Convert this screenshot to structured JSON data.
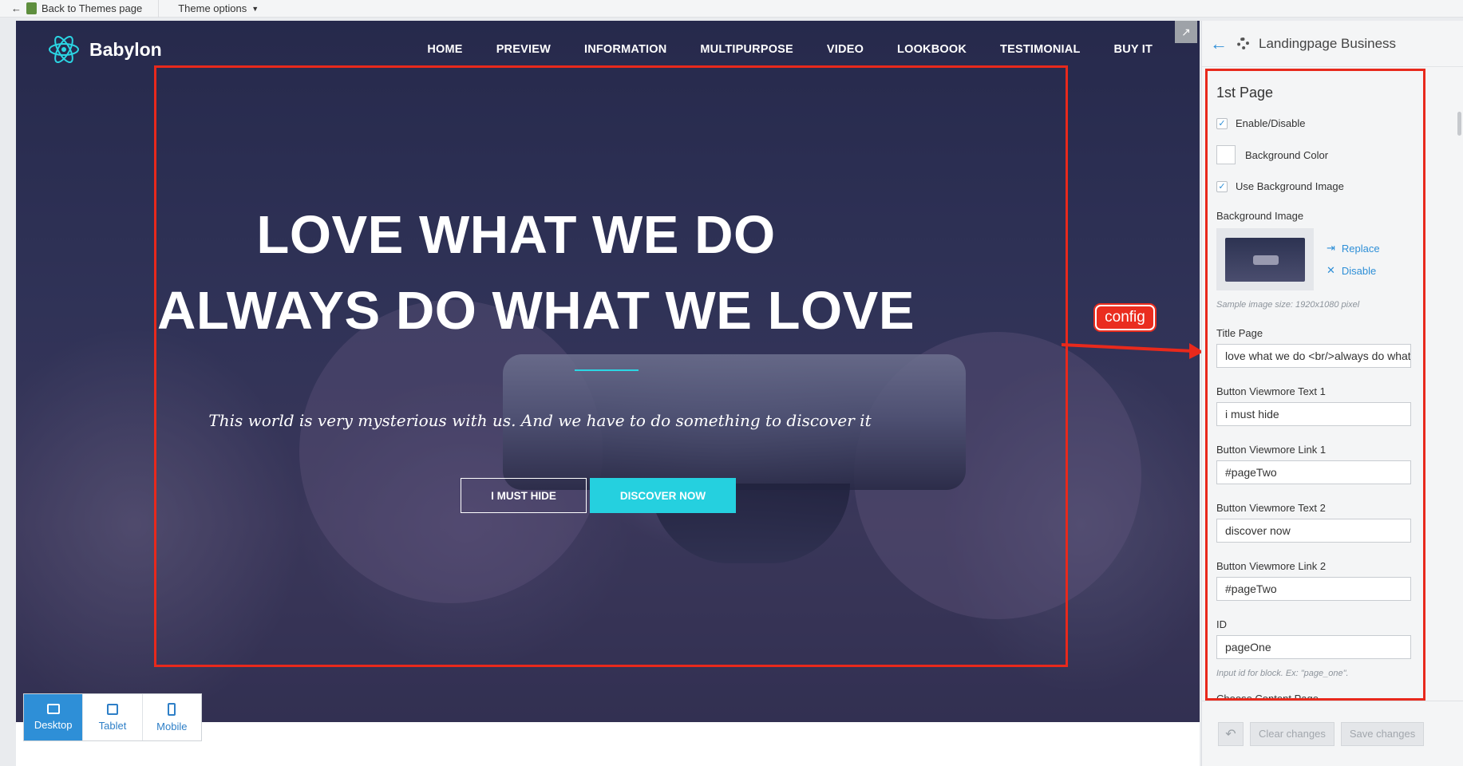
{
  "topbar": {
    "back_label": "Back to Themes page",
    "theme_options_label": "Theme options"
  },
  "site": {
    "brand": "Babylon",
    "menu": [
      "HOME",
      "PREVIEW",
      "INFORMATION",
      "MULTIPURPOSE",
      "VIDEO",
      "LOOKBOOK",
      "TESTIMONIAL",
      "BUY IT"
    ],
    "hero_line1": "LOVE WHAT WE DO",
    "hero_line2": "ALWAYS DO WHAT WE LOVE",
    "hero_subtitle": "This world is very mysterious with us. And we have to do something to discover it",
    "button1": "I MUST HIDE",
    "button2": "DISCOVER NOW",
    "accent_color": "#25d0df"
  },
  "devices": [
    {
      "label": "Desktop",
      "icon": "desktop-icon",
      "active": true
    },
    {
      "label": "Tablet",
      "icon": "tablet-icon",
      "active": false
    },
    {
      "label": "Mobile",
      "icon": "mobile-icon",
      "active": false
    }
  ],
  "annotation": {
    "config_label": "config",
    "color": "#e8291c"
  },
  "panel": {
    "title": "Landingpage Business",
    "section": "1st Page",
    "enable_label": "Enable/Disable",
    "bg_color_label": "Background Color",
    "use_bg_image_label": "Use Background Image",
    "bg_image_label": "Background Image",
    "replace_label": "Replace",
    "disable_label": "Disable",
    "sample_hint": "Sample image size: 1920x1080 pixel",
    "fields": [
      {
        "label": "Title Page",
        "value": "love what we do <br/>always do what we love"
      },
      {
        "label": "Button Viewmore Text 1",
        "value": "i must hide"
      },
      {
        "label": "Button Viewmore Link 1",
        "value": "#pageTwo"
      },
      {
        "label": "Button Viewmore Text 2",
        "value": "discover now"
      },
      {
        "label": "Button Viewmore Link 2",
        "value": "#pageTwo"
      },
      {
        "label": "ID",
        "value": "pageOne"
      }
    ],
    "id_hint": "Input id for block. Ex: \"page_one\".",
    "cut_label": "Choose Content Page",
    "clear_label": "Clear changes",
    "save_label": "Save changes"
  }
}
